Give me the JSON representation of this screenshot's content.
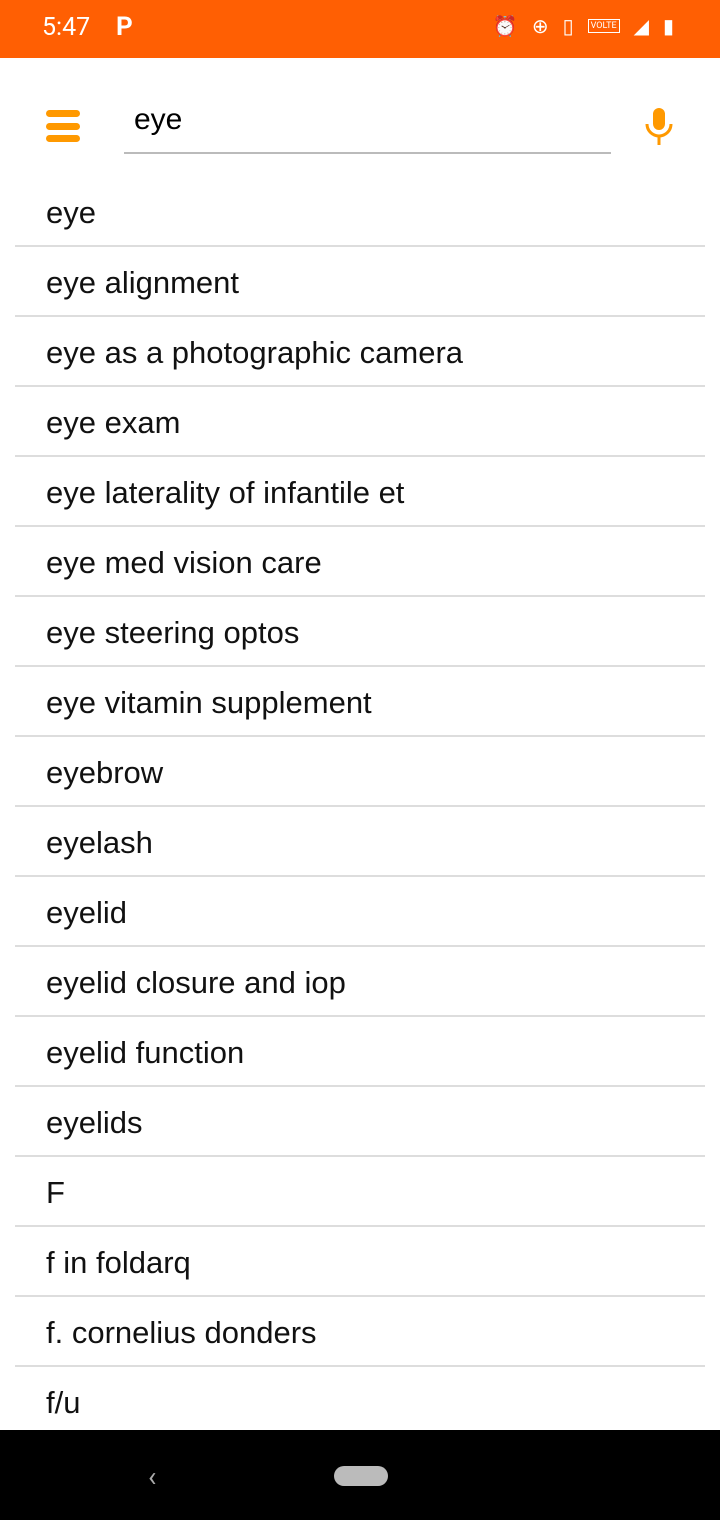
{
  "status": {
    "time": "5:47",
    "app_icon": "P",
    "icons": [
      "alarm-icon",
      "data-saver-icon",
      "vibrate-icon",
      "volte-icon",
      "signal-icon",
      "battery-charging-icon"
    ],
    "volte_label": "VOLTE"
  },
  "colors": {
    "status_bar": "#FF5F03",
    "accent": "#FF9900"
  },
  "search": {
    "value": "eye"
  },
  "suggestions": [
    "eye",
    "eye alignment",
    "eye as a photographic camera",
    "eye exam",
    "eye laterality of infantile et",
    "eye med vision care",
    "eye steering optos",
    "eye vitamin supplement",
    "eyebrow",
    "eyelash",
    "eyelid",
    "eyelid closure and iop",
    "eyelid function",
    "eyelids",
    "F",
    "f in foldarq",
    "f. cornelius donders",
    "f/u"
  ]
}
